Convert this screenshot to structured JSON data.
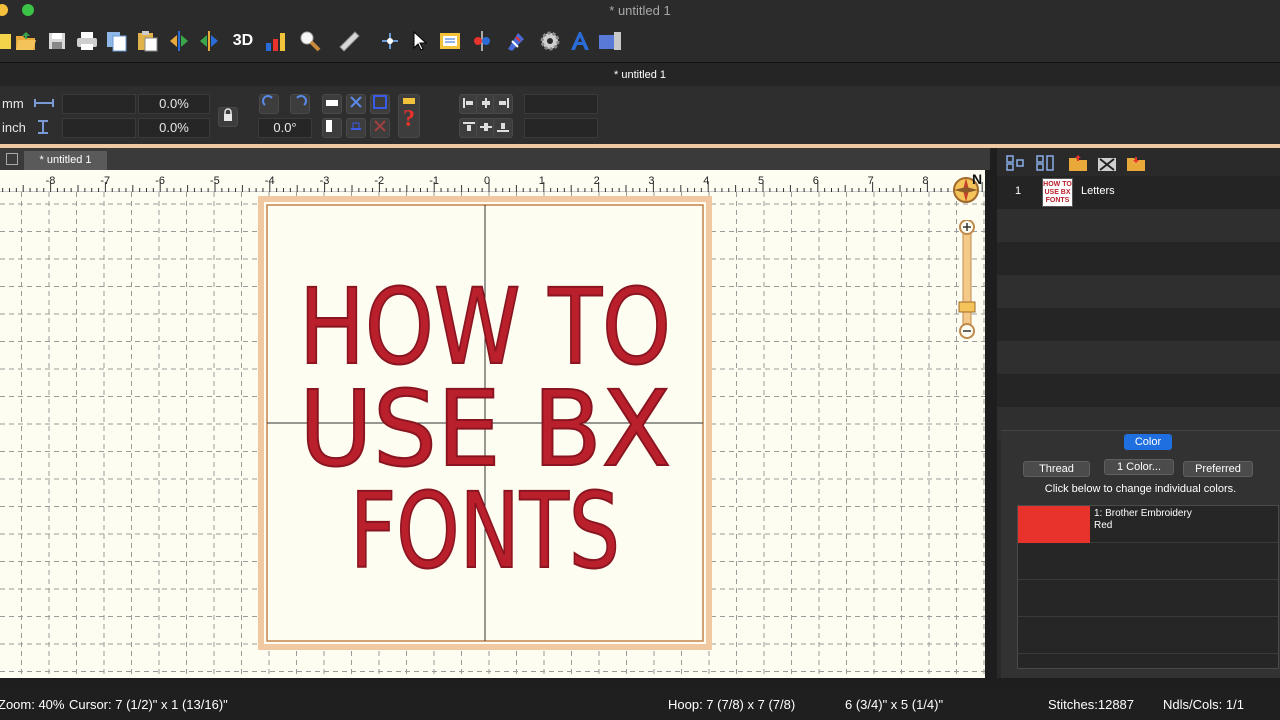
{
  "window": {
    "title": "* untitled 1"
  },
  "toolbar": {
    "icons": [
      "new-icon",
      "open-icon",
      "save-icon",
      "print-icon",
      "copy-icon",
      "paste-icon",
      "flip-horizontal-icon",
      "flip-vertical-icon",
      "3d-view-icon",
      "stitch-chart-icon",
      "zoom-icon",
      "measure-icon",
      "point-edit-icon",
      "select-arrow-icon",
      "design-center-icon",
      "needle-color-icon",
      "wizard-icon",
      "settings-gear-icon",
      "text-tool-icon",
      "transfer-icon"
    ],
    "label_3d": "3D"
  },
  "document": {
    "title": "* untitled 1",
    "tab": "* untitled 1"
  },
  "properties": {
    "unit_mm": "mm",
    "unit_inch": "inch",
    "scale_x": "0.0%",
    "scale_y": "0.0%",
    "rotation": "0.0°"
  },
  "ruler": {
    "labels": [
      "-8",
      "-7",
      "-6",
      "-5",
      "-4",
      "-3",
      "-2",
      "-1",
      "0",
      "1",
      "2",
      "3",
      "4",
      "5",
      "6",
      "7",
      "8"
    ]
  },
  "design": {
    "lines": [
      "HOW TO",
      "USE BX",
      "FONTS"
    ],
    "color": "#b9202c"
  },
  "compass": {
    "label": "N"
  },
  "objects": [
    {
      "number": "1",
      "name": "Letters"
    }
  ],
  "color_panel": {
    "tab": "Color",
    "buttons": {
      "thread": "Thread",
      "one_color": "1 Color...",
      "preferred": "Preferred"
    },
    "hint": "Click below to change individual colors.",
    "colors": [
      {
        "index_label": "1: Brother Embroidery",
        "name": "Red",
        "hex": "#e8322c"
      }
    ]
  },
  "status": {
    "zoom": "Zoom: 40%",
    "cursor": "Cursor: 7 (1/2)\" x 1 (13/16)\"",
    "hoop": "Hoop: 7 (7/8) x 7 (7/8)",
    "size": "6 (3/4)\" x 5 (1/4)\"",
    "stitches": "Stitches:12887",
    "needles": "Ndls/Cols: 1/1"
  },
  "colors": {
    "accent_blue": "#1f6fe0",
    "hoop_orange": "#f0c9a3",
    "canvas_bg": "#fdfdf2"
  }
}
